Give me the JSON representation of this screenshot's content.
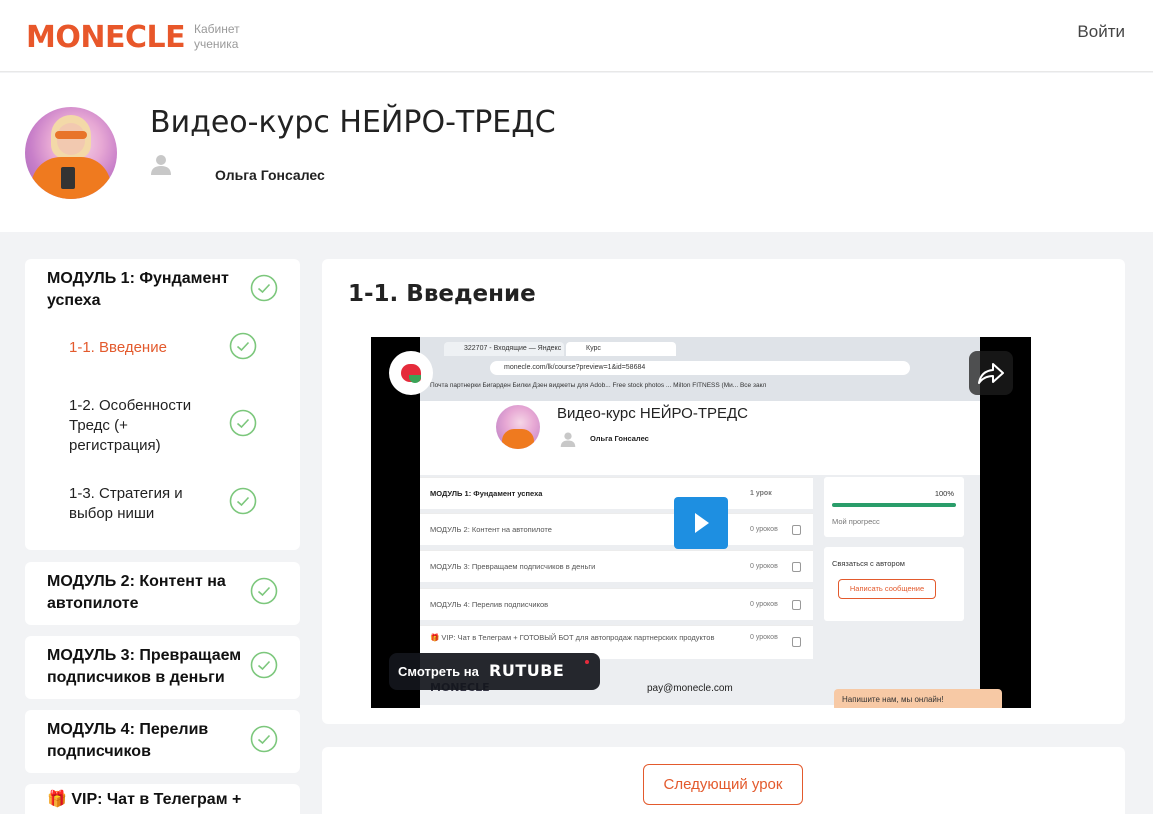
{
  "header": {
    "logo": "MONECLE",
    "logo_sub_line1": "Кабинет",
    "logo_sub_line2": "ученика",
    "login": "Войти"
  },
  "course": {
    "title": "Видео-курс НЕЙРО-ТРЕДС",
    "author": "Ольга Гонсалес"
  },
  "sidebar": {
    "modules": [
      {
        "title": "МОДУЛЬ 1: Фундамент успеха",
        "lessons": [
          {
            "label": "1-1. Введение",
            "active": true
          },
          {
            "label": "1-2. Особенности Тредс (+ регистрация)",
            "active": false
          },
          {
            "label": "1-3. Стратегия и выбор ниши",
            "active": false
          }
        ]
      },
      {
        "title": "МОДУЛЬ 2: Контент на автопилоте"
      },
      {
        "title": "МОДУЛЬ 3: Превращаем подписчиков в деньги"
      },
      {
        "title": "МОДУЛЬ 4: Перелив подписчиков"
      },
      {
        "title": "🎁 VIP: Чат в Телеграм +"
      }
    ]
  },
  "lesson": {
    "heading": "1-1. Введение",
    "next_label": "Следующий урок"
  },
  "video": {
    "watch_on": "Смотреть на",
    "watch_brand": "RUTUBE",
    "inner": {
      "tab1": "322707 - Входящие — Яндекс",
      "tab2": "Курс",
      "url": "monecle.com/lk/course?preview=1&id=58684",
      "bookmarks": "Почта   партнерки   Бигарден   Билки   Дзен   виджеты для Adob...   Free stock photos ...   Milton FITNESS (Ми...   Все закл",
      "title": "Видео-курс НЕЙРО-ТРЕДС",
      "author": "Ольга Гонсалес",
      "rows": [
        {
          "title": "МОДУЛЬ 1: Фундамент успеха",
          "count": "1 урок"
        },
        {
          "title": "МОДУЛЬ 2: Контент на автопилоте",
          "count": "0 уроков"
        },
        {
          "title": "МОДУЛЬ 3: Превращаем подписчиков в деньги",
          "count": "0 уроков"
        },
        {
          "title": "МОДУЛЬ 4: Перелив подписчиков",
          "count": "0 уроков"
        },
        {
          "title": "🎁 VIP: Чат в Телеграм + ГОТОВЫЙ БОТ для автопродаж партнерских продуктов",
          "count": "0 уроков"
        }
      ],
      "progress_pct": "100%",
      "progress_label": "Мой прогресс",
      "contact_label": "Связаться с автором",
      "contact_btn": "Написать сообщение",
      "footer_email": "pay@monecle.com",
      "footer_logo": "MONECLE",
      "chat": "Напишите нам, мы онлайн!"
    }
  },
  "colors": {
    "brand": "#e8572a",
    "accent": "#e35a2d",
    "check": "#7cc77c",
    "play": "#1e8fe1"
  }
}
